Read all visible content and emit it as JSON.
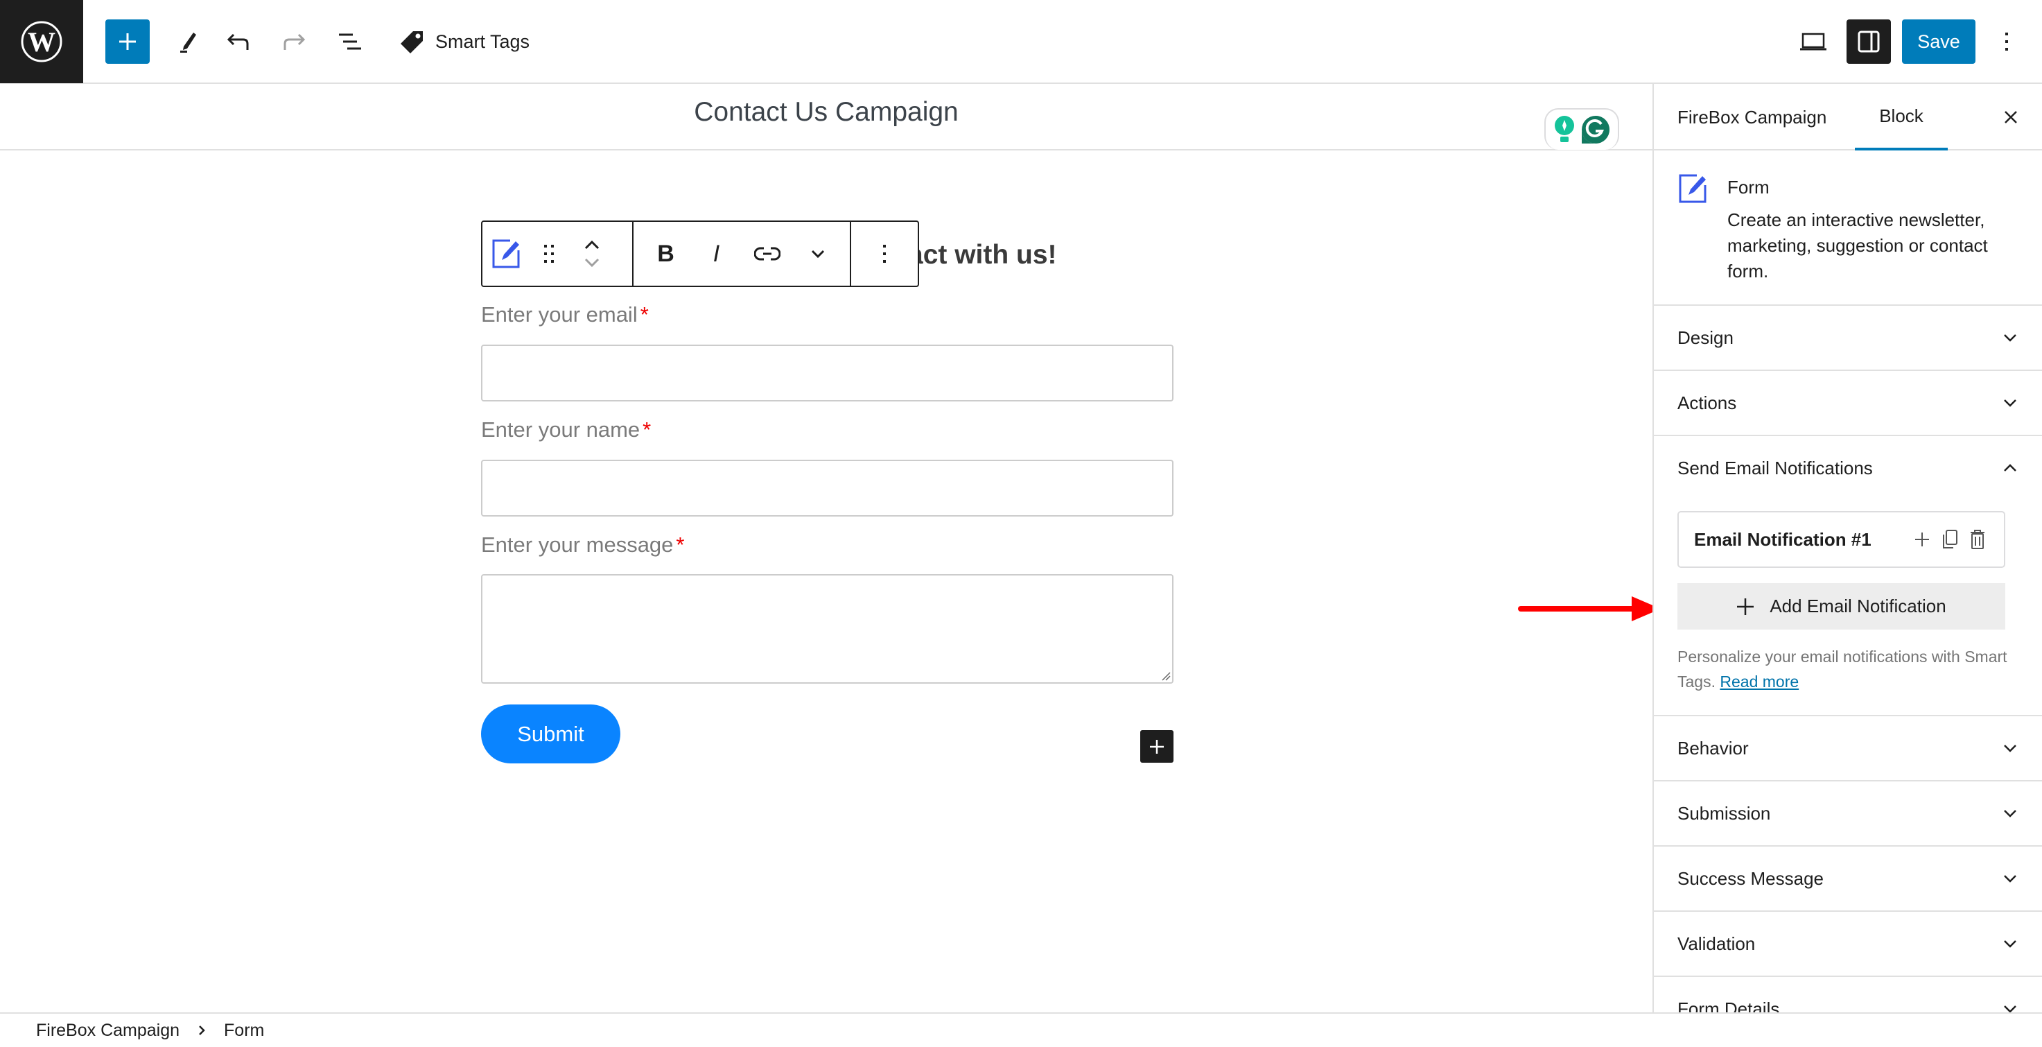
{
  "topbar": {
    "smart_tags_label": "Smart Tags",
    "save_label": "Save",
    "icons": {
      "logo": "wordpress-logo",
      "inserter": "plus-icon",
      "tools": "pencil-icon",
      "undo": "undo-icon",
      "redo": "redo-icon",
      "list_view": "list-view-icon",
      "smart_tags": "tag-icon",
      "preview": "laptop-icon",
      "settings": "sidebar-toggle-icon",
      "options": "vertical-ellipsis-icon"
    },
    "colors": {
      "accent": "#007cba",
      "dark": "#1e1e1e"
    }
  },
  "document": {
    "title": "Contact Us Campaign"
  },
  "canvas": {
    "heading_visible_text": "act with us!",
    "block_toolbar": {
      "bold_label": "B",
      "italic_label": "I"
    },
    "fields": [
      {
        "label": "Enter your email",
        "required_mark": "*",
        "value": "",
        "type": "input"
      },
      {
        "label": "Enter your name",
        "required_mark": "*",
        "value": "",
        "type": "input"
      },
      {
        "label": "Enter your message",
        "required_mark": "*",
        "value": "",
        "type": "textarea"
      }
    ],
    "submit_label": "Submit",
    "colors": {
      "submit": "#0a84ff",
      "required": "#ee0000"
    }
  },
  "sidebar": {
    "tabs": [
      {
        "label": "FireBox Campaign",
        "active": false
      },
      {
        "label": "Block",
        "active": true
      }
    ],
    "block_card": {
      "title": "Form",
      "description": "Create an interactive newsletter, marketing, suggestion or contact form."
    },
    "panels": [
      {
        "label": "Design",
        "expanded": false
      },
      {
        "label": "Actions",
        "expanded": false
      },
      {
        "label": "Send Email Notifications",
        "expanded": true
      },
      {
        "label": "Behavior",
        "expanded": false
      },
      {
        "label": "Submission",
        "expanded": false
      },
      {
        "label": "Success Message",
        "expanded": false
      },
      {
        "label": "Validation",
        "expanded": false
      },
      {
        "label": "Form Details",
        "expanded": false
      }
    ],
    "email_notifications": {
      "items": [
        {
          "title": "Email Notification #1"
        }
      ],
      "add_label": "Add Email Notification",
      "help_text": "Personalize your email notifications with Smart Tags.",
      "read_more_label": "Read more"
    }
  },
  "footer": {
    "breadcrumb": [
      "FireBox Campaign",
      "Form"
    ]
  },
  "annotation": {
    "arrow_color": "#ff0000",
    "points_to": "Add Email Notification"
  }
}
